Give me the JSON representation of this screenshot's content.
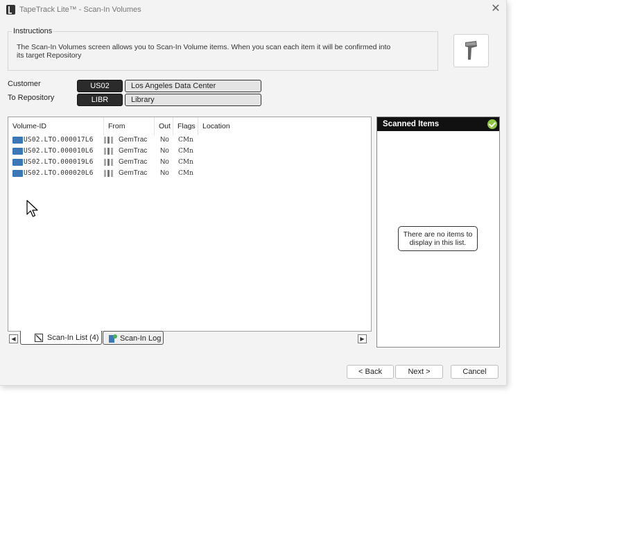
{
  "window": {
    "title": "TapeTrack Lite™ - Scan-In Volumes"
  },
  "instructions": {
    "legend": "Instructions",
    "text": "The Scan-In Volumes screen allows you to Scan-In Volume items. When you scan each item it will be confirmed into its target Repository"
  },
  "customer": {
    "label": "Customer",
    "code": "US02",
    "name": "Los Angeles Data Center"
  },
  "repository": {
    "label": "To Repository",
    "code": "LIBR",
    "name": "Library"
  },
  "list": {
    "columns": [
      "Volume-ID",
      "From",
      "Out",
      "Flags",
      "Location"
    ],
    "rows": [
      {
        "volume_id": "US02.LTO.000017L6",
        "from": "GemTrac",
        "out": "No",
        "flags": "CMn",
        "location": ""
      },
      {
        "volume_id": "US02.LTO.000010L6",
        "from": "GemTrac",
        "out": "No",
        "flags": "CMn",
        "location": ""
      },
      {
        "volume_id": "US02.LTO.000019L6",
        "from": "GemTrac",
        "out": "No",
        "flags": "CMn",
        "location": ""
      },
      {
        "volume_id": "US02.LTO.000020L6",
        "from": "GemTrac",
        "out": "No",
        "flags": "CMn",
        "location": ""
      }
    ]
  },
  "tabs": [
    {
      "label": "Scan-In List (4)",
      "icon": "tape-list-icon",
      "active": true
    },
    {
      "label": "Scan-In Log",
      "icon": "log-book-icon",
      "active": false
    }
  ],
  "scanned": {
    "title": "Scanned Items",
    "empty_message": "There are no items to display in this list."
  },
  "buttons": {
    "back": "< Back",
    "next": "Next >",
    "cancel": "Cancel"
  },
  "colors": {
    "accent_dark": "#111111",
    "volume_icon": "#3b78b8",
    "check": "#8dc63f"
  }
}
